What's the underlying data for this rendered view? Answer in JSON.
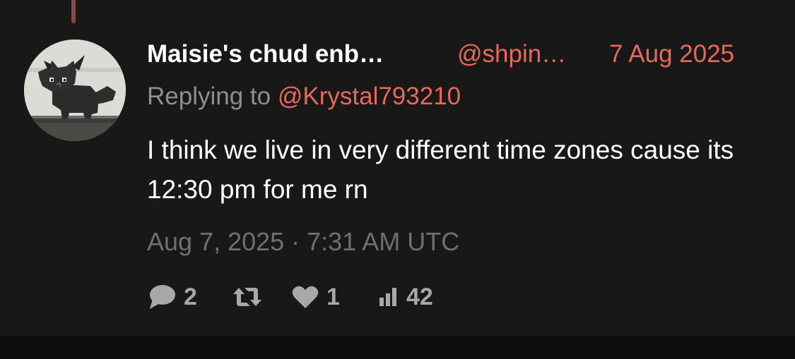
{
  "tweet": {
    "author_name": "Maisie's chud enb…",
    "handle": "@shpin…",
    "date": "7 Aug 2025",
    "replying_to_prefix": "Replying to",
    "replying_to_handle": "@Krystal793210",
    "text": "I think we live in very different time zones cause its 12:30 pm for me rn",
    "timestamp": "Aug 7, 2025 · 7:31 AM UTC"
  },
  "stats": {
    "replies": "2",
    "retweets": "",
    "likes": "1",
    "views": "42"
  },
  "icons": {
    "reply": "comment-bubble-icon",
    "retweet": "retweet-icon",
    "like": "heart-icon",
    "views": "bar-chart-icon"
  },
  "colors": {
    "background": "#181818",
    "accent": "#e8695c",
    "primary_text": "#ffffff",
    "secondary_text": "#8f8f8f",
    "icon": "#a8a8a8"
  }
}
